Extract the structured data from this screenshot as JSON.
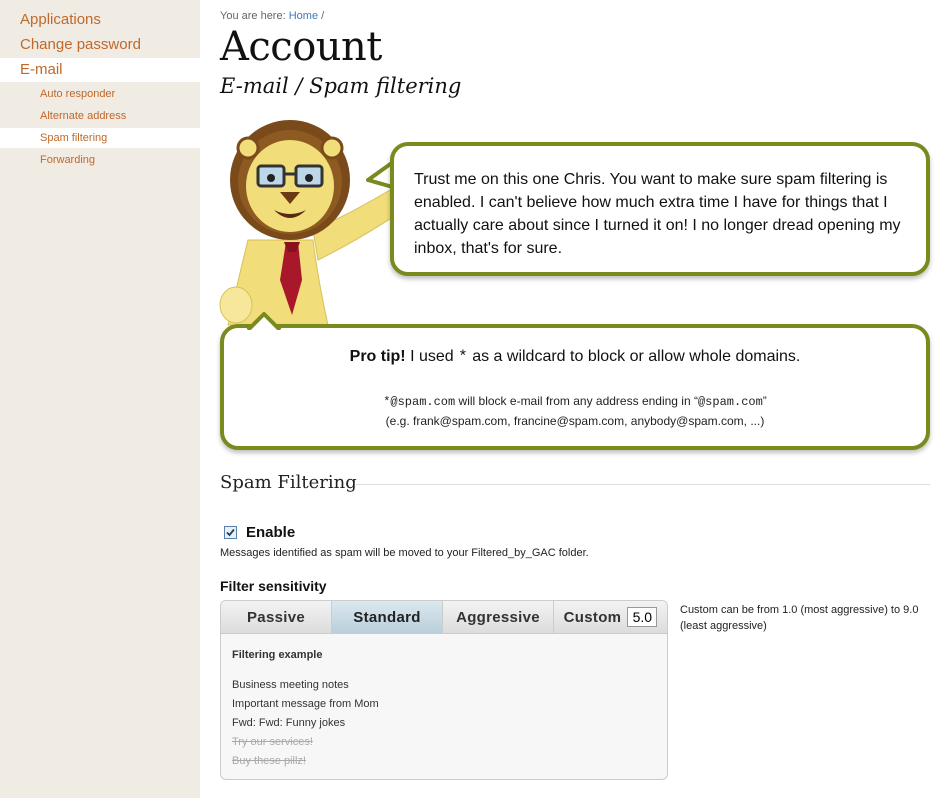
{
  "sidebar": {
    "items": [
      {
        "label": "Applications"
      },
      {
        "label": "Change password"
      },
      {
        "label": "E-mail"
      }
    ],
    "subitems": [
      {
        "label": "Auto responder"
      },
      {
        "label": "Alternate address"
      },
      {
        "label": "Spam filtering"
      },
      {
        "label": "Forwarding"
      }
    ]
  },
  "breadcrumb": {
    "prefix": "You are here:",
    "home": "Home",
    "sep": "/"
  },
  "page": {
    "title": "Account",
    "subtitle": "E-mail / Spam filtering"
  },
  "bubble": {
    "text": "Trust me on this one Chris. You want to make sure spam filtering is enabled. I can't believe how much extra time I have for things that I actually care about since I turned it on! I no longer dread opening my inbox, that's for sure."
  },
  "tip": {
    "heading": "Pro tip!",
    "text_pre": "I used",
    "wildcard": "*",
    "text_post": "as a wildcard to block or allow whole domains.",
    "example_code": "*@spam.com",
    "example_mid": "will block e-mail from any address ending in “",
    "example_code2": "@spam.com",
    "example_end": "”",
    "examples_line": "(e.g. frank@spam.com, francine@spam.com, anybody@spam.com, ...)"
  },
  "section": {
    "title": "Spam Filtering"
  },
  "enable": {
    "label": "Enable",
    "checked": true,
    "note": "Messages identified as spam will be moved to your Filtered_by_GAC folder."
  },
  "sensitivity": {
    "title": "Filter sensitivity",
    "tabs": [
      "Passive",
      "Standard",
      "Aggressive",
      "Custom"
    ],
    "selected": "Standard",
    "custom_value": "5.0",
    "custom_note": "Custom can be from 1.0 (most aggressive) to 9.0 (least aggressive)",
    "example_title": "Filtering example",
    "examples": [
      {
        "text": "Business meeting notes",
        "spam": false
      },
      {
        "text": "Important message from Mom",
        "spam": false
      },
      {
        "text": "Fwd: Fwd: Funny jokes",
        "spam": false
      },
      {
        "text": "Try our services!",
        "spam": true
      },
      {
        "text": "Buy these pillz!",
        "spam": true
      }
    ]
  },
  "colors": {
    "accent": "#7a8a1e",
    "link": "#c0692a",
    "sidebar_bg": "#f0ebe3"
  }
}
